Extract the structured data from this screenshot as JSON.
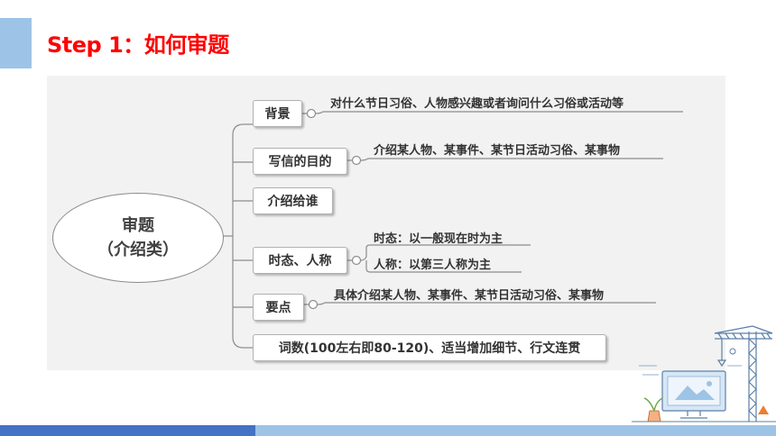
{
  "slide": {
    "title": "Step 1：如何审题"
  },
  "mindmap": {
    "root": {
      "line1": "审题",
      "line2": "（介绍类）"
    },
    "branches": [
      {
        "label": "背景",
        "notes": [
          "对什么节日习俗、人物感兴趣或者询问什么习俗或活动等"
        ]
      },
      {
        "label": "写信的目的",
        "notes": [
          "介绍某人物、某事件、某节日活动习俗、某事物"
        ]
      },
      {
        "label": "介绍给谁",
        "notes": []
      },
      {
        "label": "时态、人称",
        "notes": [
          "时态：以一般现在时为主",
          "人称：以第三人称为主"
        ]
      },
      {
        "label": "要点",
        "notes": [
          "具体介绍某人物、某事件、某节日活动习俗、某事物"
        ]
      },
      {
        "label": "词数(100左右即80-120)、适当增加细节、行文连贯",
        "notes": []
      }
    ]
  },
  "colors": {
    "title": "#ff0000",
    "accent": "#9dc3e6",
    "bar_dark": "#4472c4",
    "bar_light": "#9dc3e6",
    "panel": "#f2f2f2"
  },
  "decoration": {
    "icon": "construction-crane-computer-illustration"
  }
}
